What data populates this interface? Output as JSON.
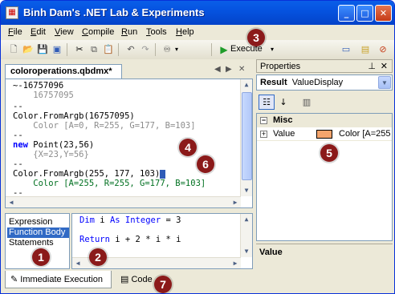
{
  "window": {
    "title": "Binh Dam's .NET Lab & Experiments"
  },
  "menu": [
    {
      "pre": "",
      "u": "F",
      "post": "ile"
    },
    {
      "pre": "",
      "u": "E",
      "post": "dit"
    },
    {
      "pre": "",
      "u": "V",
      "post": "iew"
    },
    {
      "pre": "",
      "u": "C",
      "post": "ompile"
    },
    {
      "pre": "",
      "u": "R",
      "post": "un"
    },
    {
      "pre": "",
      "u": "T",
      "post": "ools"
    },
    {
      "pre": "",
      "u": "H",
      "post": "elp"
    }
  ],
  "toolbar": {
    "execute_label": "Execute"
  },
  "document": {
    "tab_label": "coloroperations.qbdmx*"
  },
  "editor": {
    "lines": [
      "~-16757096",
      "    16757095",
      "--",
      "Color.FromArgb(16757095)",
      "    Color [A=0, R=255, G=177, B=103]",
      "--",
      "new",
      " Point(23,56)",
      "    {X=23,Y=56}",
      "--",
      "Color.FromArgb(255, 177, 103)",
      "    Color [A=255, R=255, G=177, B=103]",
      "--"
    ]
  },
  "snippet_list": {
    "items": [
      "Expression",
      "Function Body",
      "Statements"
    ],
    "selected": 1
  },
  "snippet_editor": {
    "line1_kw": "Dim",
    "line1_a": " i ",
    "line1_kw2": "As Integer",
    "line1_b": " = 3",
    "line2_kw": "Return",
    "line2_b": " i + 2 * i * i"
  },
  "bottom_tabs": {
    "immediate": "Immediate Execution",
    "code": "Code"
  },
  "properties": {
    "panel_title": "Properties",
    "object_name": "Result",
    "object_type": "ValueDisplay",
    "category": "Misc",
    "property_name": "Value",
    "property_value": "Color [A=255",
    "swatch_color": "#f4a46c",
    "description_title": "Value"
  },
  "badges": [
    "1",
    "2",
    "3",
    "4",
    "5",
    "6",
    "7"
  ],
  "icons": [
    "app-icon",
    "new-file-icon",
    "open-icon",
    "save-icon",
    "save-all-icon",
    "cut-icon",
    "copy-icon",
    "paste-icon",
    "undo-icon",
    "redo-icon",
    "binoculars-icon",
    "play-icon",
    "dropdown-icon"
  ]
}
